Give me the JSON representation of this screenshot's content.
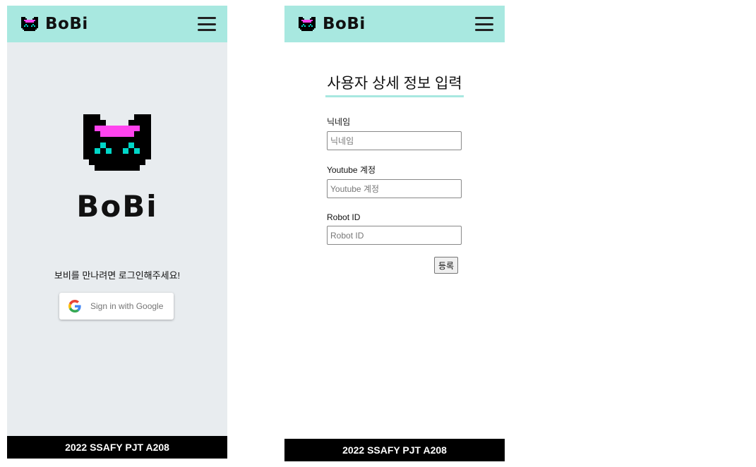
{
  "brand": {
    "name": "BoBi"
  },
  "colors": {
    "header_bg": "#a8e8e0",
    "left_bg": "#e8ecef",
    "footer_bg": "#000000",
    "logo_body": "#000000",
    "logo_glasses": "#ff44ee",
    "logo_eyes": "#00d7c8"
  },
  "login_screen": {
    "hero_title": "BoBi",
    "prompt": "보비를 만나려면 로그인해주세요!",
    "google_button": {
      "label": "Sign in with Google",
      "icon": "google-g-icon"
    }
  },
  "register_screen": {
    "title": "사용자 상세 정보 입력",
    "fields": [
      {
        "label": "닉네임",
        "placeholder": "닉네임"
      },
      {
        "label": "Youtube 계정",
        "placeholder": "Youtube 계정"
      },
      {
        "label": "Robot ID",
        "placeholder": "Robot ID"
      }
    ],
    "submit_label": "등록"
  },
  "footer": {
    "text": "2022 SSAFY PJT A208"
  },
  "icons": {
    "menu": "hamburger-menu-icon",
    "logo": "pixel-bear-logo-icon"
  }
}
